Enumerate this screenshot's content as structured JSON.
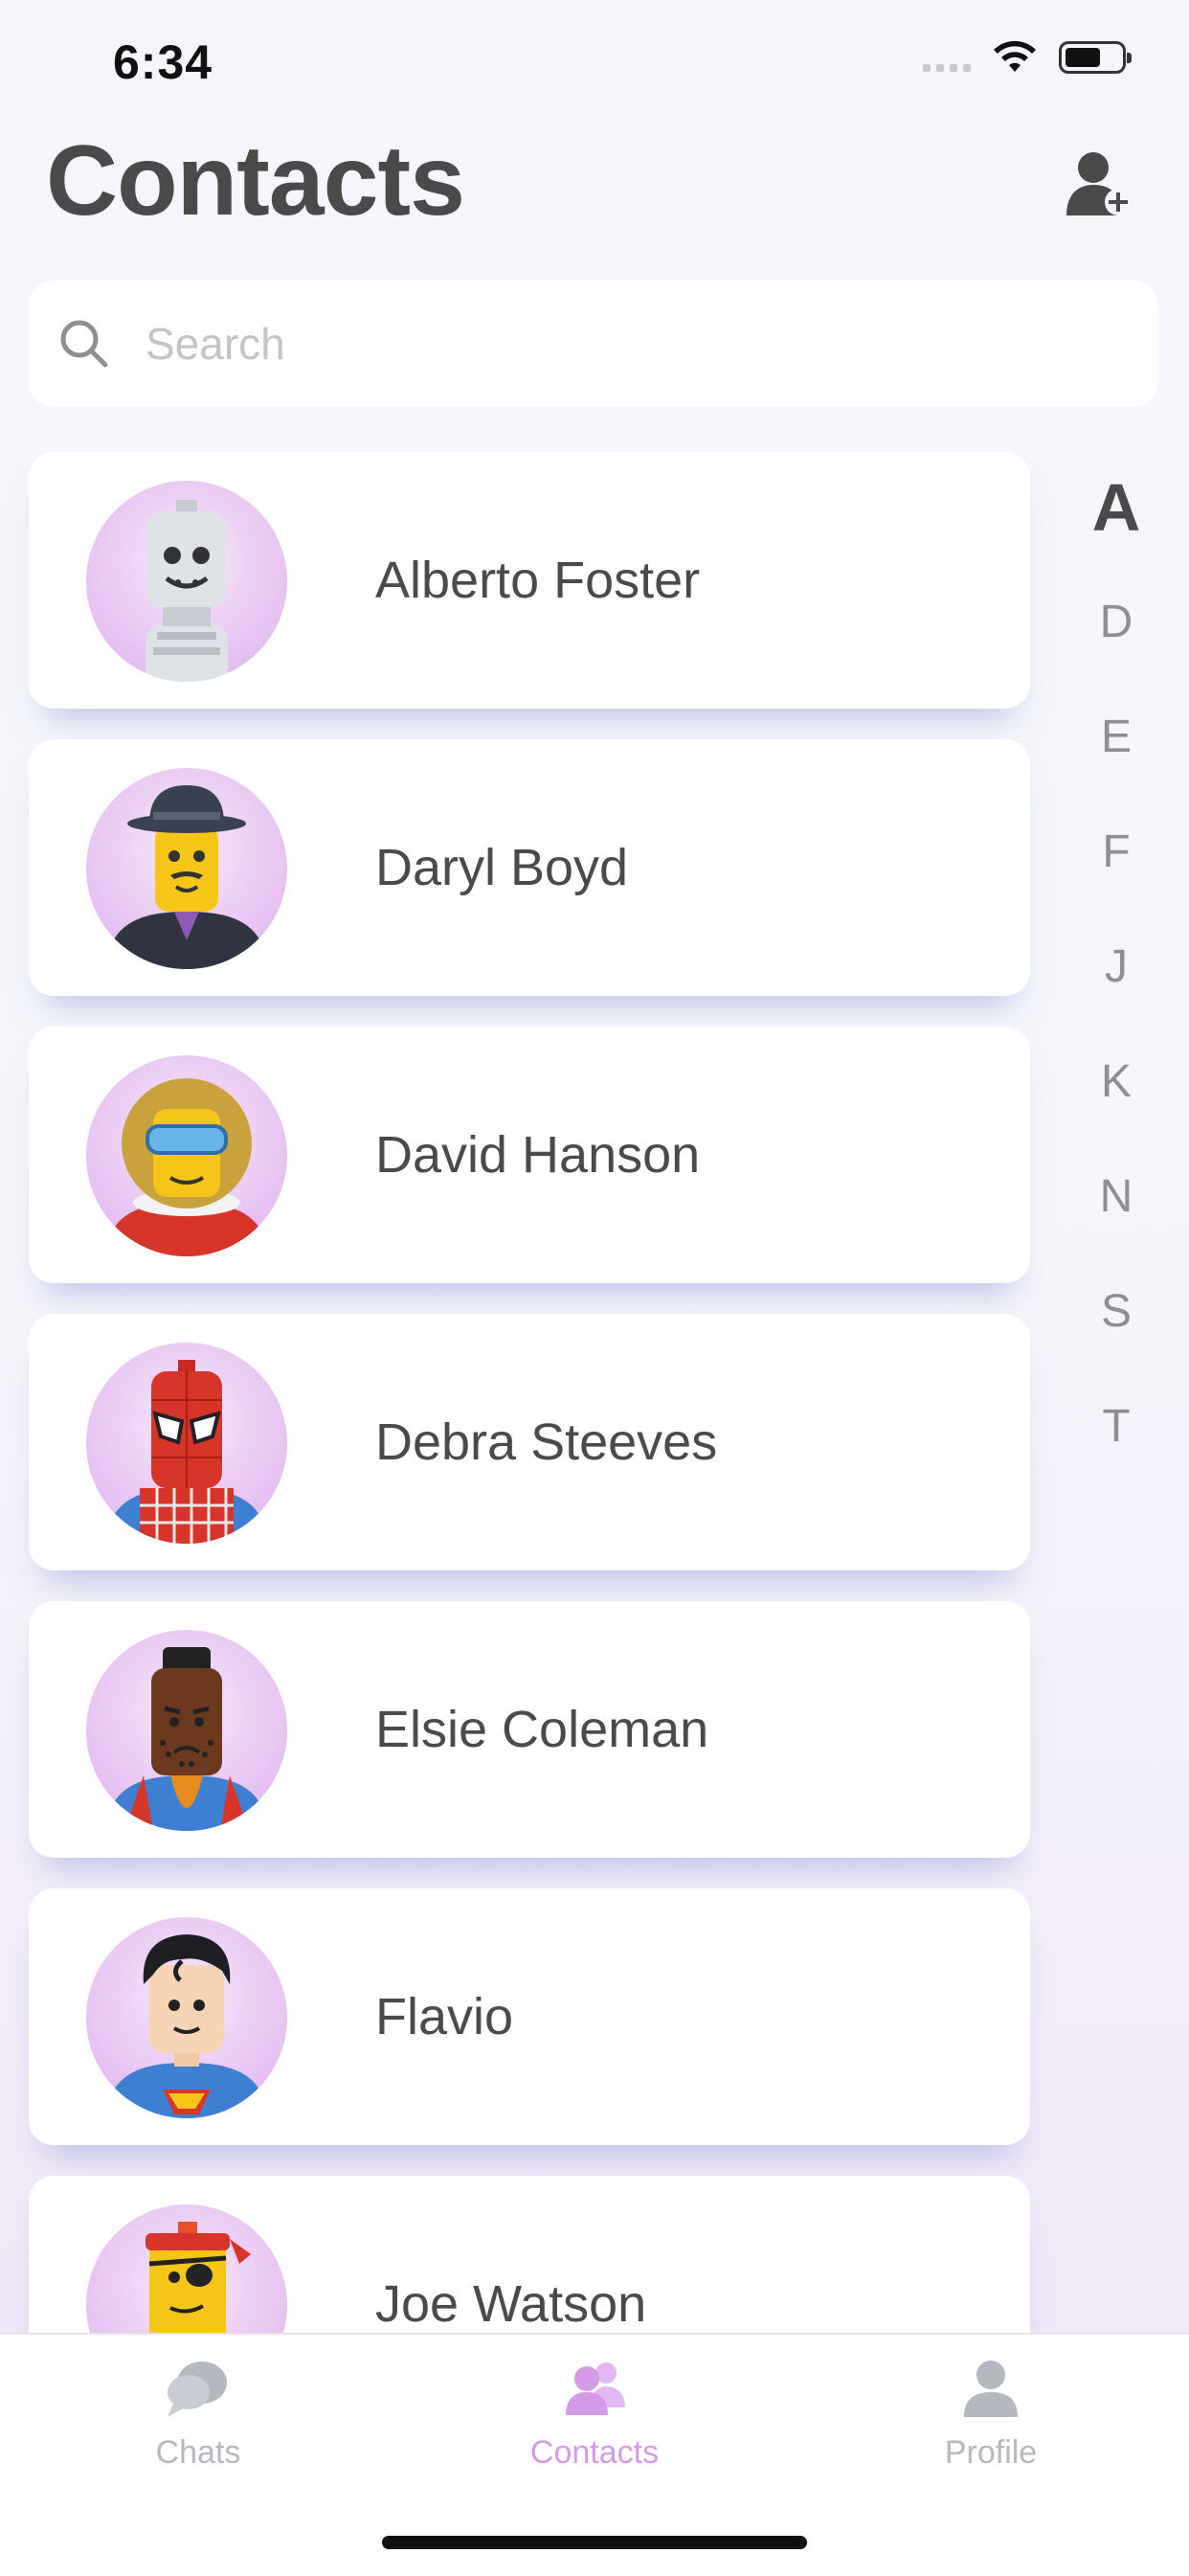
{
  "status_bar": {
    "time": "6:34"
  },
  "header": {
    "title": "Contacts",
    "add_icon": "add-contact-icon"
  },
  "search": {
    "placeholder": "Search",
    "value": "",
    "icon": "search-icon"
  },
  "contacts": [
    {
      "name": "Alberto Foster",
      "avatar": "skeleton-avatar"
    },
    {
      "name": "Daryl Boyd",
      "avatar": "gentleman-avatar"
    },
    {
      "name": "David Hanson",
      "avatar": "explorer-avatar"
    },
    {
      "name": "Debra Steeves",
      "avatar": "spider-avatar"
    },
    {
      "name": "Elsie Coleman",
      "avatar": "mohawk-avatar"
    },
    {
      "name": "Flavio",
      "avatar": "superhero-avatar"
    },
    {
      "name": "Joe Watson",
      "avatar": "pirate-avatar"
    }
  ],
  "alphabet_index": {
    "letters": [
      "A",
      "D",
      "E",
      "F",
      "J",
      "K",
      "N",
      "S",
      "T"
    ],
    "active": "A"
  },
  "tab_bar": {
    "tabs": [
      {
        "label": "Chats",
        "icon": "chat-bubble-icon"
      },
      {
        "label": "Contacts",
        "icon": "contacts-icon"
      },
      {
        "label": "Profile",
        "icon": "person-icon"
      }
    ],
    "active": "Contacts"
  },
  "colors": {
    "accent": "#d59be6",
    "text": "#4a4a4a",
    "inactive": "#b5b8bf",
    "avatar_bg": "#e9c6f3"
  }
}
